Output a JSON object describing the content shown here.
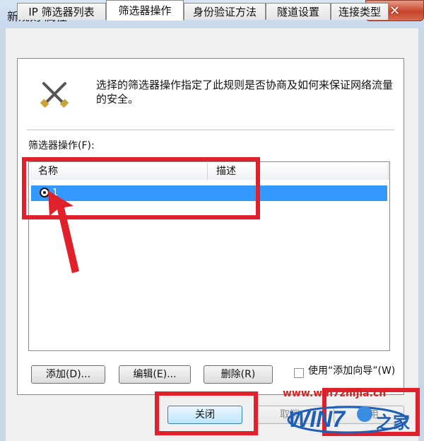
{
  "window": {
    "title": "新规则 属性",
    "close_glyph": "✕"
  },
  "tabs": [
    {
      "label": "IP 筛选器列表",
      "active": false
    },
    {
      "label": "筛选器操作",
      "active": true
    },
    {
      "label": "身份验证方法",
      "active": false
    },
    {
      "label": "隧道设置",
      "active": false
    },
    {
      "label": "连接类型",
      "active": false
    }
  ],
  "panel": {
    "icon": "crossed-tools-icon",
    "description": "选择的筛选器操作指定了此规则是否协商及如何来保证网络流量的安全。",
    "list_label": "筛选器操作(F):",
    "columns": [
      "名称",
      "描述"
    ],
    "rows": [
      {
        "selected": true,
        "name": "1",
        "description": ""
      }
    ]
  },
  "buttons": {
    "add": "添加(D)...",
    "edit": "编辑(E)...",
    "remove": "删除(R)",
    "wizard_checkbox": "使用“添加向导”(W)",
    "wizard_checked": false,
    "close": "关闭",
    "cancel": "取消",
    "apply": "应用"
  },
  "watermark": {
    "url": "www.win7zhijia.cn",
    "logo_text": "WIN7",
    "logo_suffix": "之家"
  },
  "colors": {
    "annotation": "#e0202a",
    "selection": "#3399ff",
    "watermark": "#d52222"
  }
}
